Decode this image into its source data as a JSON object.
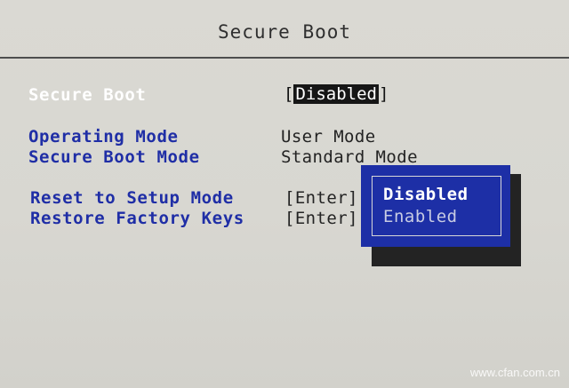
{
  "header": {
    "title": "Secure Boot"
  },
  "settings": {
    "secure_boot": {
      "label": "Secure Boot",
      "bracket_open": "[",
      "value": "Disabled",
      "bracket_close": "]"
    },
    "operating_mode": {
      "label": "Operating Mode",
      "value": "User Mode"
    },
    "secure_boot_mode": {
      "label": "Secure Boot Mode",
      "value": "Standard Mode"
    },
    "reset_to_setup_mode": {
      "label": "Reset to Setup Mode",
      "action": "[Enter]"
    },
    "restore_factory_keys": {
      "label": "Restore Factory Keys",
      "action": "[Enter]"
    }
  },
  "dropdown": {
    "options": [
      "Disabled",
      "Enabled"
    ],
    "selected": "Disabled"
  },
  "watermark": "www.cfan.com.cn",
  "colors": {
    "background": "#d9d8d2",
    "label_blue": "#1f2ea6",
    "popup_blue": "#1d2fa6",
    "highlight": "#161616"
  }
}
